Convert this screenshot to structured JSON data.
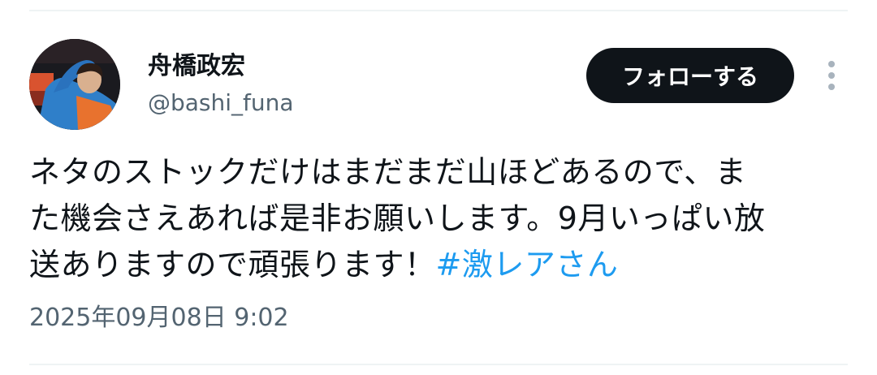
{
  "user": {
    "display_name": "舟橋政宏",
    "handle": "@bashi_funa"
  },
  "actions": {
    "follow_label": "フォローする",
    "more_icon": "vertical-ellipsis-icon"
  },
  "tweet": {
    "lines": [
      "ネタのストックだけはまだまだ山ほどあるので、ま",
      "た機会さえあれば是非お願いします。9月いっぱい放",
      "送ありますので頑張ります！"
    ],
    "hashtag": "#激レアさん",
    "timestamp": "2025年09月08日 9:02"
  },
  "colors": {
    "text": "#0f1419",
    "secondary": "#536471",
    "link": "#1d9bf0",
    "button_bg": "#0f1419",
    "divider": "#eff3f4"
  }
}
